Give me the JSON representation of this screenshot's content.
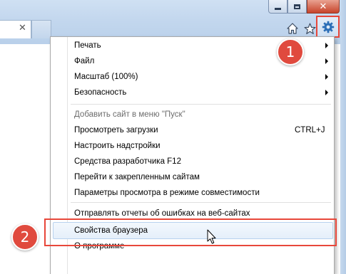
{
  "window": {
    "close_glyph": "✕",
    "accent_color": "#e8473a"
  },
  "tab": {
    "close_glyph": "✕"
  },
  "toolbar": {
    "icons": [
      "home-icon",
      "star-icon",
      "gear-icon"
    ]
  },
  "annotations": {
    "badge_1": "1",
    "badge_2": "2"
  },
  "menu": {
    "items": [
      {
        "label": "Печать",
        "submenu": true
      },
      {
        "label": "Файл",
        "submenu": true
      },
      {
        "label": "Масштаб (100%)",
        "submenu": true
      },
      {
        "label": "Безопасность",
        "submenu": true
      },
      {
        "label": "Добавить сайт в меню \"Пуск\"",
        "disabled": true
      },
      {
        "label": "Просмотреть загрузки",
        "shortcut": "CTRL+J"
      },
      {
        "label": "Настроить надстройки"
      },
      {
        "label": "Средства разработчика F12"
      },
      {
        "label": "Перейти к закрепленным сайтам"
      },
      {
        "label": "Параметры просмотра в режиме совместимости"
      },
      {
        "label": "Отправлять отчеты об ошибках на веб-сайтах"
      },
      {
        "label": "Свойства браузера",
        "highlighted": true
      },
      {
        "label": "О программе"
      }
    ]
  }
}
